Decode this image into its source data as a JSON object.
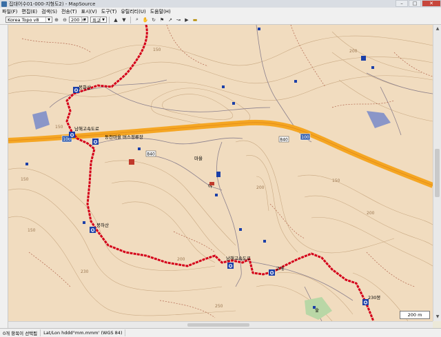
{
  "window": {
    "title": "집대어수01-000-지형도2) - MapSource"
  },
  "menu": [
    "파일(F)",
    "편집(E)",
    "검색(S)",
    "전송(T)",
    "표시(V)",
    "도구(T)",
    "유틸리티(U)",
    "도움말(H)"
  ],
  "toolbar": {
    "map_product": "Korea Topo v8",
    "zoom_level": "200 m",
    "detail": "최고"
  },
  "map": {
    "road_number_labels": [
      "100",
      "100",
      "840",
      "840"
    ],
    "contour_labels": [
      "150",
      "150",
      "150",
      "200",
      "230",
      "200",
      "200",
      "150",
      "150",
      "200",
      "250"
    ],
    "place_labels": [
      "봉화산",
      "봉하산",
      "남해고속도로",
      "남해고속도로",
      "동천마을 버스정류장",
      "마을",
      "야",
      "230봉",
      "고개",
      "숲"
    ],
    "scale_label": "200 m"
  },
  "status": {
    "selection": "0개 항목이 선택됨",
    "coord_format": "Lat/Lon hddd°mm.mmm' (WGS 84)"
  },
  "colors": {
    "map_bg": "#f1dcbf",
    "highway": "#f5a623",
    "track": "#d4001a",
    "contour": "#c9a983",
    "water": "#8a96c8"
  }
}
